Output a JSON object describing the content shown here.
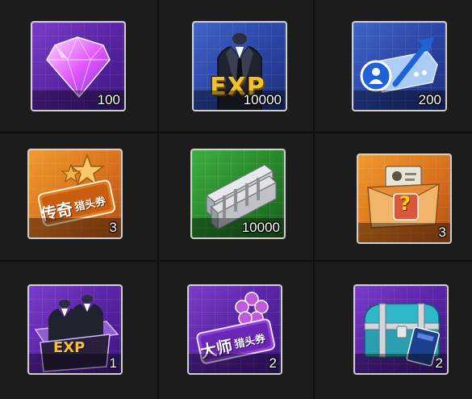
{
  "items": [
    {
      "name": "Diamond",
      "count": "100",
      "rarity": "purple",
      "icon": "diamond-icon"
    },
    {
      "name": "Suit EXP",
      "count": "10000",
      "rarity": "blue",
      "icon": "suit-exp-icon",
      "label": "EXP"
    },
    {
      "name": "Upgrade Ticket",
      "count": "200",
      "rarity": "blue",
      "icon": "upgrade-ticket-icon"
    },
    {
      "name": "Legendary Headhunt Coupon",
      "count": "3",
      "rarity": "orange",
      "icon": "legendary-coupon-icon",
      "label_main": "传奇",
      "label_sub": "猎头券"
    },
    {
      "name": "Steel Bars",
      "count": "10000",
      "rarity": "green",
      "icon": "steel-bars-icon"
    },
    {
      "name": "Mystery Box",
      "count": "3",
      "rarity": "orange",
      "icon": "mystery-box-icon",
      "label": "?"
    },
    {
      "name": "Suit EXP Box",
      "count": "1",
      "rarity": "purple",
      "icon": "exp-box-icon",
      "label": "EXP"
    },
    {
      "name": "Master Headhunt Coupon",
      "count": "2",
      "rarity": "purple",
      "icon": "master-coupon-icon",
      "label_main": "大师",
      "label_sub": "猎头券"
    },
    {
      "name": "Treasure Chest",
      "count": "2",
      "rarity": "purple",
      "icon": "treasure-chest-icon"
    }
  ],
  "colors": {
    "purple": "#6a2fb8",
    "blue": "#2f4cae",
    "orange": "#e07a1f",
    "green": "#2e8f31",
    "count_text": "#ffffff"
  }
}
